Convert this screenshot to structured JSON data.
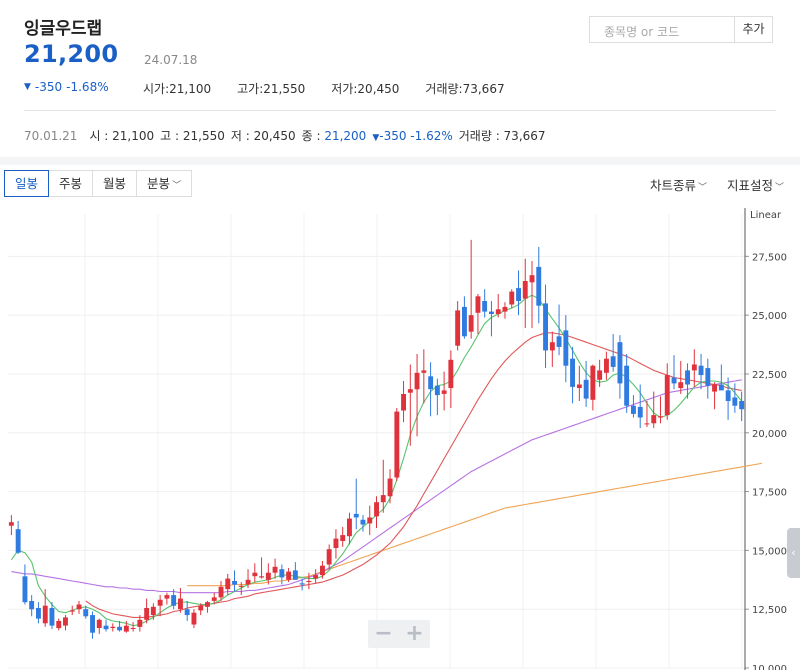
{
  "stock": {
    "name": "잉글우드랩",
    "price": "21,200",
    "date": "24.07.18",
    "change_abs": "-350",
    "change_pct": "-1.68%",
    "open_label": "시가",
    "open": "21,100",
    "high_label": "고가",
    "high": "21,550",
    "low_label": "저가",
    "low": "20,450",
    "volume_label": "거래량",
    "volume": "73,667"
  },
  "search": {
    "placeholder": "종목명 or 코드",
    "add_label": "추가"
  },
  "history": {
    "date": "70.01.21",
    "open_label": "시",
    "open": "21,100",
    "high_label": "고",
    "high": "21,550",
    "low_label": "저",
    "low": "20,450",
    "close_label": "종",
    "close": "21,200",
    "change_abs": "-350",
    "change_pct": "-1.62%",
    "volume_label": "거래량",
    "volume": "73,667"
  },
  "tabs": [
    {
      "label": "일봉",
      "active": true
    },
    {
      "label": "주봉",
      "active": false
    },
    {
      "label": "월봉",
      "active": false
    },
    {
      "label": "분봉",
      "active": false
    }
  ],
  "settings": {
    "chart_type": "차트종류",
    "indicator": "지표설정"
  },
  "colors": {
    "up": "#e0323c",
    "down": "#2f7be0",
    "accent": "#1a5fc6",
    "ma5": "#57c46d",
    "ma20": "#e0585a",
    "ma60": "#b673e3",
    "ma120": "#f0a455"
  },
  "icons": {
    "handle": "chevron-left-icon",
    "zoom_out": "minus-icon",
    "zoom_in": "plus-icon"
  },
  "chart_data": {
    "type": "candlestick",
    "scale_label": "Linear",
    "ylim": [
      10000,
      29300
    ],
    "yticks": [
      "27,500",
      "25,000",
      "22,500",
      "20,000",
      "17,500",
      "15,000",
      "12,500",
      "10,000"
    ],
    "candles": [
      [
        16050,
        16500,
        15650,
        16200
      ],
      [
        15900,
        16250,
        14850,
        14900
      ],
      [
        13900,
        14400,
        12700,
        12800
      ],
      [
        12850,
        13100,
        12200,
        12500
      ],
      [
        12550,
        12800,
        11900,
        12100
      ],
      [
        11900,
        13350,
        11750,
        12650
      ],
      [
        12550,
        12800,
        11650,
        11800
      ],
      [
        11700,
        12100,
        11600,
        12000
      ],
      [
        11800,
        12250,
        11600,
        12150
      ],
      [
        12400,
        12650,
        12250,
        12450
      ],
      [
        12500,
        12850,
        12300,
        12700
      ],
      [
        12500,
        12650,
        12100,
        12200
      ],
      [
        12250,
        12400,
        11250,
        11500
      ],
      [
        11700,
        12100,
        11450,
        12050
      ],
      [
        11800,
        12050,
        11550,
        11650
      ],
      [
        11700,
        11900,
        11550,
        11750
      ],
      [
        11750,
        12000,
        11550,
        11600
      ],
      [
        11550,
        12000,
        11500,
        11800
      ],
      [
        11700,
        11950,
        11550,
        11700
      ],
      [
        11750,
        12250,
        11550,
        12050
      ],
      [
        12050,
        12950,
        11900,
        12550
      ],
      [
        12250,
        12750,
        12050,
        12600
      ],
      [
        12650,
        13100,
        12200,
        12900
      ],
      [
        12950,
        13200,
        12700,
        13100
      ],
      [
        13100,
        13350,
        12500,
        12650
      ],
      [
        12500,
        13400,
        12350,
        12950
      ],
      [
        12500,
        12850,
        12000,
        12250
      ],
      [
        11850,
        12500,
        11700,
        12350
      ],
      [
        12450,
        12750,
        12250,
        12650
      ],
      [
        12600,
        12850,
        12350,
        12800
      ],
      [
        12850,
        13200,
        12700,
        13000
      ],
      [
        13000,
        13700,
        12850,
        13450
      ],
      [
        13350,
        14000,
        13100,
        13800
      ],
      [
        13700,
        14150,
        13250,
        13550
      ],
      [
        13450,
        13650,
        13100,
        13500
      ],
      [
        13550,
        14200,
        13400,
        13750
      ],
      [
        13900,
        14450,
        13650,
        14050
      ],
      [
        13850,
        14700,
        13800,
        13900
      ],
      [
        13750,
        14450,
        13550,
        14050
      ],
      [
        14050,
        14650,
        13800,
        14300
      ],
      [
        14200,
        14400,
        13550,
        13850
      ],
      [
        13750,
        14250,
        13650,
        14100
      ],
      [
        14150,
        14500,
        13750,
        13750
      ],
      [
        13600,
        13800,
        13300,
        13550
      ],
      [
        13700,
        14050,
        13350,
        13700
      ],
      [
        13800,
        14200,
        13600,
        13950
      ],
      [
        13950,
        14550,
        13800,
        14350
      ],
      [
        14400,
        15250,
        14200,
        15050
      ],
      [
        15100,
        15900,
        14650,
        15500
      ],
      [
        15400,
        16000,
        15150,
        15650
      ],
      [
        15600,
        16600,
        15250,
        16350
      ],
      [
        16550,
        18050,
        15900,
        16400
      ],
      [
        16300,
        16500,
        15800,
        16100
      ],
      [
        16150,
        16900,
        15650,
        16400
      ],
      [
        16450,
        17300,
        15950,
        17050
      ],
      [
        17050,
        18850,
        16600,
        17350
      ],
      [
        17300,
        18450,
        17000,
        18050
      ],
      [
        18100,
        21050,
        17950,
        20900
      ],
      [
        20950,
        22200,
        20450,
        21650
      ],
      [
        21700,
        22900,
        19450,
        21850
      ],
      [
        21850,
        23350,
        19850,
        22550
      ],
      [
        22550,
        23550,
        21250,
        22650
      ],
      [
        22400,
        23000,
        20700,
        21850
      ],
      [
        22000,
        22300,
        20750,
        21600
      ],
      [
        21650,
        22600,
        20950,
        21800
      ],
      [
        21900,
        23500,
        21050,
        23100
      ],
      [
        23700,
        25600,
        23500,
        25200
      ],
      [
        25350,
        25800,
        24000,
        24100
      ],
      [
        24300,
        28200,
        24000,
        25000
      ],
      [
        25100,
        25900,
        24200,
        25800
      ],
      [
        25600,
        26100,
        24900,
        25150
      ],
      [
        25150,
        25600,
        24100,
        25050
      ],
      [
        25050,
        25900,
        24900,
        25250
      ],
      [
        25150,
        25550,
        24850,
        25350
      ],
      [
        25450,
        26100,
        25300,
        26000
      ],
      [
        26150,
        26900,
        25000,
        25600
      ],
      [
        25700,
        27400,
        24450,
        26450
      ],
      [
        26400,
        27300,
        24450,
        26700
      ],
      [
        27050,
        27900,
        24650,
        25400
      ],
      [
        25500,
        26300,
        22750,
        23500
      ],
      [
        23500,
        24300,
        22800,
        23850
      ],
      [
        24100,
        25450,
        23300,
        23650
      ],
      [
        24350,
        25000,
        22150,
        22850
      ],
      [
        23150,
        23650,
        21250,
        21950
      ],
      [
        21900,
        22850,
        21350,
        22050
      ],
      [
        22250,
        23050,
        21100,
        21450
      ],
      [
        21400,
        22900,
        20950,
        22850
      ],
      [
        22250,
        23100,
        21950,
        22650
      ],
      [
        22550,
        23450,
        22250,
        23150
      ],
      [
        23250,
        24200,
        22600,
        22800
      ],
      [
        23850,
        24150,
        21450,
        22100
      ],
      [
        22850,
        23350,
        20850,
        21150
      ],
      [
        21150,
        21600,
        20650,
        20800
      ],
      [
        21100,
        22050,
        20200,
        20650
      ],
      [
        20400,
        21350,
        20250,
        20400
      ],
      [
        20400,
        21750,
        20200,
        20750
      ],
      [
        20650,
        21550,
        20400,
        20700
      ],
      [
        20750,
        22950,
        20550,
        22450
      ],
      [
        22350,
        23300,
        21850,
        22100
      ],
      [
        21900,
        23050,
        21650,
        22150
      ],
      [
        22650,
        22950,
        21450,
        22050
      ],
      [
        22650,
        23550,
        21950,
        22900
      ],
      [
        22850,
        23350,
        21850,
        22450
      ],
      [
        22750,
        23150,
        21450,
        22000
      ],
      [
        21750,
        22150,
        21000,
        22050
      ],
      [
        22050,
        22900,
        21950,
        21800
      ],
      [
        21800,
        22350,
        20550,
        21350
      ],
      [
        21500,
        22100,
        20850,
        21150
      ],
      [
        21350,
        21750,
        20500,
        21000
      ]
    ],
    "ma5": [
      14600,
      15000,
      14900,
      14500,
      13500,
      13050,
      12700,
      12400,
      12350,
      12450,
      12550,
      12600,
      12500,
      12350,
      12100,
      12000,
      11950,
      11900,
      11800,
      11850,
      12000,
      12150,
      12350,
      12550,
      12700,
      12800,
      12800,
      12750,
      12700,
      12700,
      12750,
      12900,
      13100,
      13250,
      13400,
      13550,
      13650,
      13700,
      13750,
      13850,
      13950,
      13950,
      13900,
      13850,
      13800,
      13800,
      13900,
      14150,
      14500,
      14850,
      15300,
      15750,
      16000,
      16250,
      16500,
      16750,
      17200,
      18000,
      18900,
      19900,
      20700,
      21300,
      21750,
      22000,
      22050,
      22200,
      22650,
      23200,
      23650,
      24150,
      24650,
      24900,
      25050,
      25200,
      25300,
      25450,
      25700,
      25850,
      25700,
      25250,
      24850,
      24450,
      24000,
      23500,
      23000,
      22550,
      22250,
      22150,
      22200,
      22450,
      22550,
      22350,
      22050,
      21700,
      21250,
      20850,
      20650,
      20750,
      20950,
      21250,
      21600,
      21950,
      22150,
      22200,
      22200,
      22150,
      22000,
      21700,
      21350
    ],
    "ma20": [
      null,
      null,
      null,
      null,
      null,
      null,
      null,
      null,
      null,
      null,
      null,
      12850,
      12650,
      12500,
      12400,
      12300,
      12250,
      12200,
      12150,
      12150,
      12150,
      12200,
      12250,
      12300,
      12400,
      12450,
      12550,
      12600,
      12650,
      12700,
      12750,
      12800,
      12850,
      12950,
      13000,
      13050,
      13150,
      13200,
      13250,
      13300,
      13350,
      13400,
      13450,
      13500,
      13550,
      13600,
      13650,
      13750,
      13850,
      13950,
      14100,
      14250,
      14400,
      14600,
      14800,
      15050,
      15300,
      15650,
      16000,
      16450,
      16900,
      17400,
      17900,
      18400,
      18900,
      19400,
      19900,
      20400,
      20900,
      21400,
      21850,
      22300,
      22700,
      23050,
      23350,
      23600,
      23850,
      24050,
      24150,
      24250,
      24250,
      24200,
      24150,
      24050,
      23950,
      23850,
      23750,
      23650,
      23550,
      23450,
      23350,
      23250,
      23100,
      22950,
      22800,
      22650,
      22550,
      22450,
      22350,
      22300,
      22250,
      22200,
      22150,
      22100,
      22050,
      22000,
      21900,
      21850,
      21800
    ],
    "ma60": [
      14100,
      14050,
      14000,
      14000,
      13950,
      13900,
      13850,
      13800,
      13750,
      13700,
      13650,
      13600,
      13550,
      13500,
      13450,
      13450,
      13400,
      13400,
      13350,
      13350,
      13300,
      13300,
      13250,
      13250,
      13250,
      13200,
      13200,
      13200,
      13200,
      13200,
      13200,
      13200,
      13250,
      13250,
      13250,
      13300,
      13300,
      13350,
      13400,
      13450,
      13500,
      13550,
      13650,
      13750,
      13850,
      13950,
      14100,
      14250,
      14400,
      14550,
      14750,
      14950,
      15150,
      15350,
      15550,
      15750,
      15950,
      16150,
      16350,
      16550,
      16750,
      16950,
      17150,
      17350,
      17550,
      17750,
      17950,
      18150,
      18350,
      18500,
      18650,
      18800,
      18950,
      19100,
      19250,
      19400,
      19550,
      19700,
      19800,
      19900,
      20000,
      20100,
      20200,
      20300,
      20400,
      20500,
      20600,
      20700,
      20800,
      20900,
      21000,
      21100,
      21200,
      21300,
      21400,
      21500,
      21600,
      21700,
      21750,
      21800,
      21850,
      21900,
      21950,
      22000,
      22050,
      22100,
      22150,
      22200,
      22250
    ],
    "ma120": [
      null,
      null,
      null,
      null,
      null,
      null,
      null,
      null,
      null,
      null,
      null,
      null,
      null,
      null,
      null,
      null,
      null,
      null,
      null,
      null,
      null,
      null,
      null,
      null,
      null,
      null,
      13500,
      13500,
      13500,
      13500,
      13500,
      13500,
      13500,
      13550,
      13550,
      13550,
      13600,
      13600,
      13650,
      13700,
      13700,
      13750,
      13800,
      13850,
      13900,
      14000,
      14100,
      14200,
      14300,
      14400,
      14500,
      14600,
      14700,
      14800,
      14900,
      15000,
      15100,
      15200,
      15300,
      15400,
      15500,
      15600,
      15700,
      15800,
      15900,
      16000,
      16100,
      16200,
      16300,
      16400,
      16500,
      16600,
      16700,
      16800,
      16850,
      16900,
      16950,
      17000,
      17050,
      17100,
      17150,
      17200,
      17250,
      17300,
      17350,
      17400,
      17450,
      17500,
      17550,
      17600,
      17650,
      17700,
      17750,
      17800,
      17850,
      17900,
      17950,
      18000,
      18050,
      18100,
      18150,
      18200,
      18250,
      18300,
      18350,
      18400,
      18450,
      18500,
      18550,
      18600,
      18650,
      18700
    ]
  }
}
